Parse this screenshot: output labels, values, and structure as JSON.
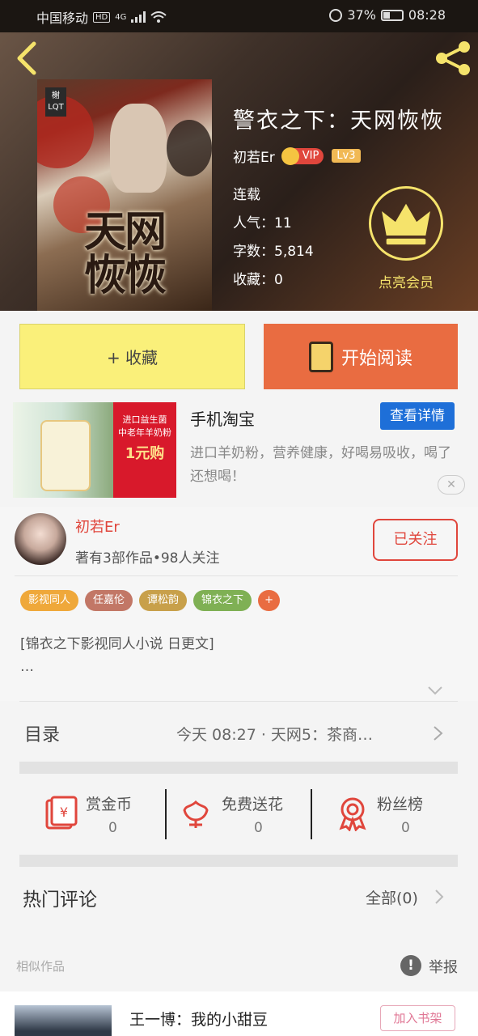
{
  "status_bar": {
    "carrier": "中国移动",
    "network_badge": "HD",
    "signal": "4G",
    "battery": "37%",
    "time": "08:28"
  },
  "header": {
    "back_icon": "chevron-left-icon",
    "share_icon": "share-icon",
    "cover_title": "天网恢恢",
    "cover_logo": "榭 LQT"
  },
  "book": {
    "title": "警衣之下：天网恢恢",
    "author": "初若Er",
    "vip_label": "VIP",
    "level": "Lv3",
    "status": "连载",
    "popularity": "人气：11",
    "word_count": "字数：5,814",
    "favorites": "收藏：0",
    "vip_cta": "点亮会员"
  },
  "actions": {
    "collect_label": "+ 收藏",
    "read_label": "开始阅读"
  },
  "ad": {
    "image_line1": "进口益生菌",
    "image_line2": "中老年羊奶粉",
    "image_price": "1元购",
    "title": "手机淘宝",
    "detail_label": "查看详情",
    "description": "进口羊奶粉，营养健康，好喝易吸收，喝了还想喝！",
    "close_label": "✕"
  },
  "author": {
    "name": "初若Er",
    "stats": "著有3部作品•98人关注",
    "follow_label": "已关注"
  },
  "tags": [
    {
      "label": "影视同人",
      "color": "#efa83a"
    },
    {
      "label": "任嘉伦",
      "color": "#c27766"
    },
    {
      "label": "谭松韵",
      "color": "#c8a04a"
    },
    {
      "label": "锦衣之下",
      "color": "#7fb054"
    },
    {
      "label": "+",
      "color": "#e96c41"
    }
  ],
  "description": {
    "line1": "[锦衣之下影视同人小说 日更文]",
    "line2": "…"
  },
  "catalog": {
    "label": "目录",
    "latest": "今天 08:27 · 天网5：茶商…"
  },
  "rewards": [
    {
      "label": "赏金币",
      "count": "0",
      "icon": "red-envelope-icon"
    },
    {
      "label": "免费送花",
      "count": "0",
      "icon": "flower-icon"
    },
    {
      "label": "粉丝榜",
      "count": "0",
      "icon": "medal-icon"
    }
  ],
  "comments": {
    "label": "热门评论",
    "all_label": "全部(0)"
  },
  "similar": {
    "label": "相似作品",
    "report_label": "举报",
    "items": [
      {
        "title": "王一博：我的小甜豆",
        "add_label": "加入书架"
      }
    ]
  },
  "colors": {
    "accent_red": "#e0463c",
    "read_button": "#e96c41",
    "collect_button": "#faf07a",
    "vip_gold": "#f5e36b",
    "ad_blue": "#1e6fd8"
  }
}
